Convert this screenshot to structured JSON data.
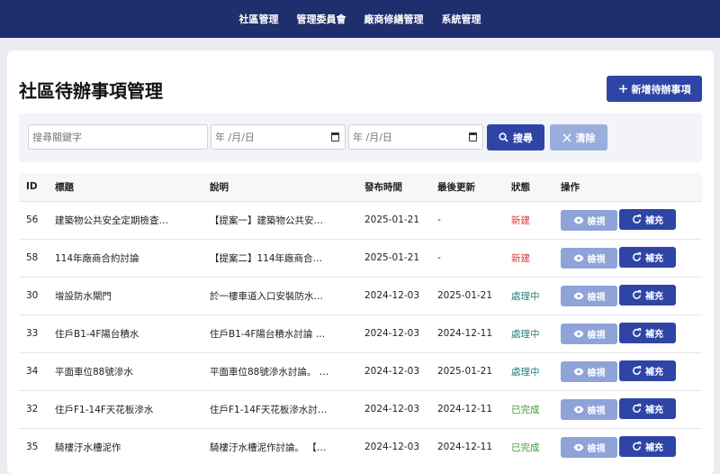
{
  "nav": [
    "社區管理",
    "管理委員會",
    "廠商修繕管理",
    "系統管理"
  ],
  "page_title": "社區待辦事項管理",
  "add_button": "新增待辦事項",
  "filter": {
    "search_placeholder": "搜尋關鍵字",
    "date_placeholder": "年 /月/日",
    "search_button": "搜尋",
    "clear_button": "清除"
  },
  "table": {
    "headers": [
      "ID",
      "標題",
      "說明",
      "發布時間",
      "最後更新",
      "狀態",
      "操作"
    ],
    "rows": [
      {
        "id": "56",
        "title": "建築物公共安全定期檢查…",
        "desc": "【提案一】建築物公共安…",
        "published": "2025-01-21",
        "updated": "-",
        "status": "新建",
        "status_kind": "new"
      },
      {
        "id": "58",
        "title": "114年廠商合約討論",
        "desc": "【提案二】114年廠商合…",
        "published": "2025-01-21",
        "updated": "-",
        "status": "新建",
        "status_kind": "new"
      },
      {
        "id": "30",
        "title": "增設防水閘門",
        "desc": "於一樓車道入口安裝防水…",
        "published": "2024-12-03",
        "updated": "2025-01-21",
        "status": "處理中",
        "status_kind": "doing"
      },
      {
        "id": "33",
        "title": "住戶B1-4F陽台積水",
        "desc": "住戶B1-4F陽台積水討論 …",
        "published": "2024-12-03",
        "updated": "2024-12-11",
        "status": "處理中",
        "status_kind": "doing"
      },
      {
        "id": "34",
        "title": "平面車位88號滲水",
        "desc": "平面車位88號滲水討論。 …",
        "published": "2024-12-03",
        "updated": "2025-01-21",
        "status": "處理中",
        "status_kind": "doing"
      },
      {
        "id": "32",
        "title": "住戶F1-14F天花板滲水",
        "desc": "住戶F1-14F天花板滲水討…",
        "published": "2024-12-03",
        "updated": "2024-12-11",
        "status": "已完成",
        "status_kind": "done"
      },
      {
        "id": "35",
        "title": "騎樓汙水槽泥作",
        "desc": "騎樓汙水槽泥作討論。 【…",
        "published": "2024-12-03",
        "updated": "2024-12-11",
        "status": "已完成",
        "status_kind": "done"
      }
    ],
    "view_label": "檢視",
    "supplement_label": "補充"
  }
}
